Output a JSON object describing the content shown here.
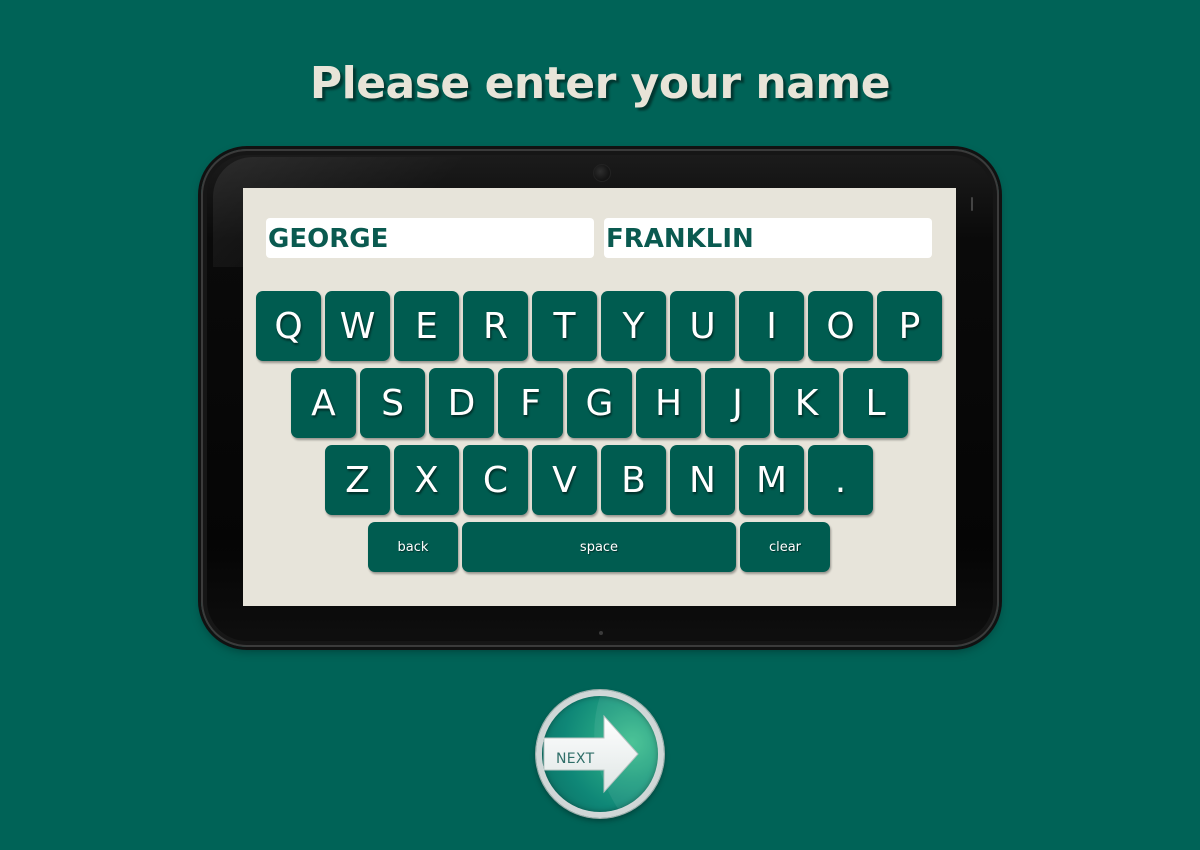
{
  "title": "Please enter your name",
  "fields": {
    "first_name": "GEORGE",
    "last_name": "FRANKLIN"
  },
  "keyboard": {
    "row1": [
      "Q",
      "W",
      "E",
      "R",
      "T",
      "Y",
      "U",
      "I",
      "O",
      "P"
    ],
    "row2": [
      "A",
      "S",
      "D",
      "F",
      "G",
      "H",
      "J",
      "K",
      "L"
    ],
    "row3": [
      "Z",
      "X",
      "C",
      "V",
      "B",
      "N",
      "M",
      "."
    ],
    "back": "back",
    "space": "space",
    "clear": "clear"
  },
  "next_button": {
    "label": "NEXT",
    "icon": "arrow-right-icon"
  },
  "colors": {
    "background": "#006357",
    "key": "#005c50",
    "screen": "#e7e4da",
    "field_text": "#0a5a50",
    "title": "#e8e4d8"
  }
}
